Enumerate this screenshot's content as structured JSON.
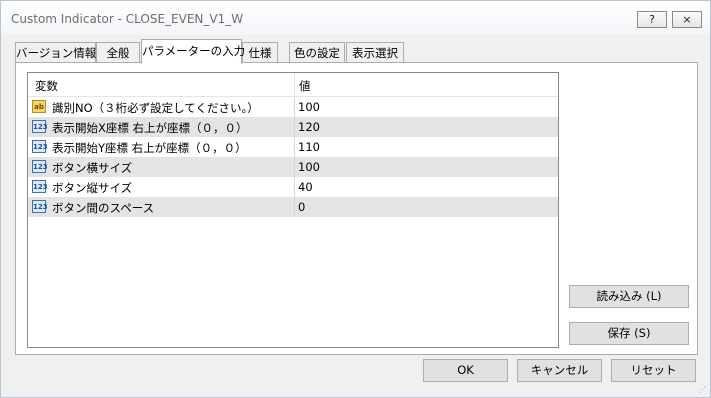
{
  "window": {
    "title": "Custom Indicator - CLOSE_EVEN_V1_W"
  },
  "titlebar": {
    "help_label": "?",
    "close_label": "×"
  },
  "tabs": [
    {
      "label": "バージョン情報"
    },
    {
      "label": "全般"
    },
    {
      "label": "パラメーターの入力"
    },
    {
      "label": "仕様"
    },
    {
      "label": "色の設定"
    },
    {
      "label": "表示選択"
    }
  ],
  "grid": {
    "headers": {
      "variable": "変数",
      "value": "値"
    },
    "rows": [
      {
        "type_icon": "ab",
        "name": "識別NO（３桁必ず設定してください。）",
        "value": "100"
      },
      {
        "type_icon": "123",
        "name": "表示開始X座標 右上が座標（０，０）",
        "value": "120"
      },
      {
        "type_icon": "123",
        "name": "表示開始Y座標 右上が座標（０，０）",
        "value": "110"
      },
      {
        "type_icon": "123",
        "name": "ボタン横サイズ",
        "value": "100"
      },
      {
        "type_icon": "123",
        "name": "ボタン縦サイズ",
        "value": "40"
      },
      {
        "type_icon": "123",
        "name": "ボタン間のスペース",
        "value": "0"
      }
    ]
  },
  "side_buttons": {
    "load_label": "読み込み (L)",
    "save_label": "保存 (S)"
  },
  "footer": {
    "ok_label": "OK",
    "cancel_label": "キャンセル",
    "reset_label": "リセット"
  }
}
